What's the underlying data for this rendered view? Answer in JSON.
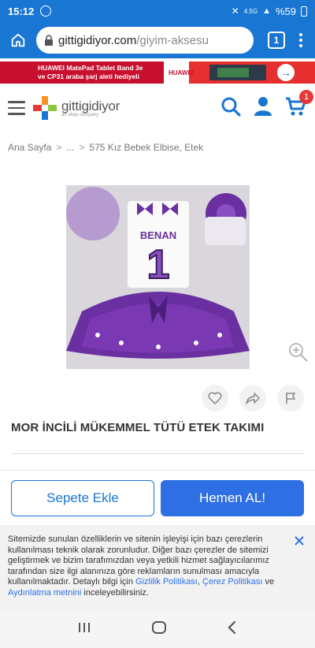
{
  "status_bar": {
    "time": "15:12",
    "network": "4.5G",
    "battery": "%59"
  },
  "browser": {
    "url_host": "gittigidiyor.com",
    "url_path": "/giyim-aksesu",
    "tab_count": "1"
  },
  "ad": {
    "line1": "HUAWEI MatePad Tablet Band 3e",
    "line2": "ve CP31 araba şarj aleti hediyeli",
    "brand": "HUAWEI",
    "arrow": "→"
  },
  "header": {
    "logo_name": "gittigidiyor",
    "logo_sub": "an ebay company",
    "cart_count": "1"
  },
  "breadcrumb": {
    "home": "Ana Sayfa",
    "ellipsis": "...",
    "current": "575 Kız Bebek Elbise, Etek",
    "sep": ">"
  },
  "product": {
    "image_name_text": "BENAN",
    "image_digit": "1",
    "title": "MOR İNCİLİ MÜKEMMEL TÜTÜ ETEK TAKIMI"
  },
  "cta": {
    "add_to_cart": "Sepete Ekle",
    "buy_now": "Hemen AL!"
  },
  "cookie": {
    "text_main": "Sitemizde sunulan özelliklerin ve sitenin işleyişi için bazı çerezlerin kullanılması teknik olarak zorunludur. Diğer bazı çerezler de sitemizi geliştirmek ve bizim tarafımızdan veya yetkili hizmet sağlayıcılarımız tarafından size ilgi alanınıza göre reklamların sunulması amacıyla kullanılmaktadır. Detaylı bilgi için ",
    "link1": "Gizlilik Politikası",
    "comma": ", ",
    "link2": "Çerez Politikası",
    "and": " ve ",
    "link3": "Aydınlatma metnini",
    "text_end": " inceleyebilirsiniz."
  },
  "icons": [
    "home-icon",
    "lock-icon",
    "menu-icon",
    "search-icon",
    "user-icon",
    "cart-icon",
    "zoom-icon",
    "heart-icon",
    "share-icon",
    "flag-icon",
    "close-icon",
    "recents-icon",
    "home-nav-icon",
    "back-icon"
  ],
  "colors": {
    "primary": "#1976d2",
    "buy_button": "#2f6fe4",
    "badge": "#e53935",
    "tutu": "#6a2fa0"
  }
}
